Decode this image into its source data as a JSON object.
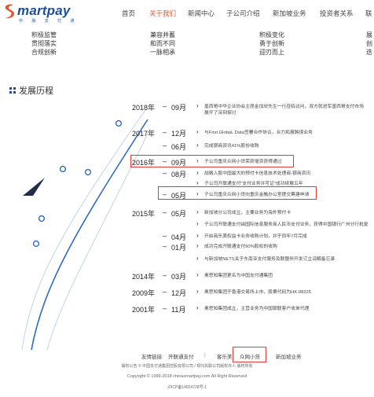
{
  "header": {
    "logo_text": "martpay",
    "logo_sub": "中 融 支 付 通",
    "nav": [
      "首页",
      "关于我们",
      "新闻中心",
      "子公司介绍",
      "新加坡业务",
      "投资者关系",
      "联"
    ],
    "active_index": 1
  },
  "slogans": [
    {
      "lines": [
        "积极监管",
        "贯彻落实",
        "合规创新"
      ]
    },
    {
      "lines": [
        "兼容并蓄",
        "和而不同",
        "一脉相承"
      ]
    },
    {
      "lines": [
        "积极变化",
        "勇于创新",
        "迎刃而上"
      ]
    },
    {
      "lines": [
        "展",
        "创",
        "迭"
      ]
    }
  ],
  "section_title": "发展历程",
  "timeline": [
    {
      "year": "2018年",
      "month": "09月",
      "text": [
        "墨西哥中华企业协会主席金加欣先生一行莅临访问，双方就进军墨西哥支付市场",
        "展开了深刻探讨"
      ]
    },
    {
      "year": "2017年",
      "month": "12月",
      "text": [
        "与First GlobaL Data签署合作协议，合力拓展跨境业务"
      ]
    },
    {
      "year": "",
      "month": "06月",
      "text": [
        "完成银商资讯41%股份收购"
      ]
    },
    {
      "year": "2016年",
      "month": "09月",
      "text": [
        "子公司重庆众网小贷荣获增资获得通过"
      ]
    },
    {
      "year": "",
      "month": "08月",
      "text": [
        "战略入股中国最大的预付卡信息技术处理商-银商资讯"
      ]
    },
    {
      "year": "",
      "month": "",
      "text": [
        "子公司开联通支付“支付业务许可证”成功续展五年"
      ]
    },
    {
      "year": "",
      "month": "05月",
      "text": [
        "子公司重庆众网小贷向重庆金融办公室提交筹建申请"
      ]
    },
    {
      "year": "2015年",
      "month": "05月",
      "text": [
        "新加坡分公司成立，主要业务为海外预付卡"
      ]
    },
    {
      "year": "",
      "month": "",
      "text": [
        "子公司开联通支付由国际信息服务商人民币支付业务，获得中国银行广州分行批复"
      ]
    },
    {
      "year": "",
      "month": "04月",
      "text": [
        "开启商乐美权益卡业务收购计划，并于同年7月完成"
      ]
    },
    {
      "year": "",
      "month": "01月",
      "text": [
        "成功完成开联通支付90%股权的收购"
      ]
    },
    {
      "year": "",
      "month": "",
      "text": [
        "与新加坡NETS关于东南亚支付服务及联盟伴开发订立谅解备忘录"
      ]
    },
    {
      "year": "2014年",
      "month": "03月",
      "text": [
        "奥思知集团更名为中国支付通集团"
      ]
    },
    {
      "year": "2009年",
      "month": "12月",
      "text": [
        "奥思知集团于香港交易所上市，股票代码为HK.08325"
      ]
    },
    {
      "year": "2001年",
      "month": "11月",
      "text": [
        "奥思知集团成立，主营业务为中国银联客户收单代理"
      ]
    }
  ],
  "footer": {
    "links_label": "友情链接:",
    "links": [
      "开联通支付",
      "|",
      "客乐美",
      "众网小贷",
      "新加坡业务"
    ],
    "copyright_line1": "版权公告 © 中国支付通集团控股有限公司 / 现归关联公司版权许人 版权所有",
    "copyright_line2": "Copyright © 1999-2018 chinasmartpay.com All Right Reserved",
    "icp": "沪ICP备14024728号-1"
  },
  "colors": {
    "accent": "#e8542f",
    "brand": "#1b4f9c",
    "highlight_box": "#e53935",
    "arrow": "#1e56b0"
  }
}
